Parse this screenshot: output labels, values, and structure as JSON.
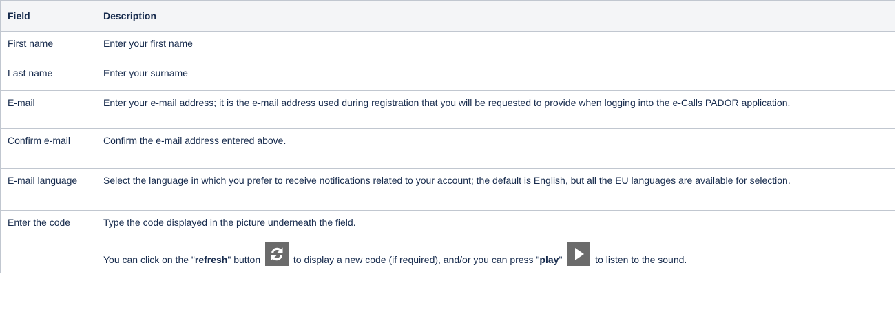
{
  "table": {
    "header": {
      "field": "Field",
      "description": "Description"
    },
    "rows": {
      "first_name": {
        "field": "First name",
        "description": "Enter your first name"
      },
      "last_name": {
        "field": "Last name",
        "description": "Enter your surname"
      },
      "email": {
        "field": "E-mail",
        "description": "Enter your e-mail address; it is the e-mail address used during registration that you will be requested to provide when logging into the e-Calls PADOR application."
      },
      "confirm_email": {
        "field": "Confirm e-mail",
        "description": "Confirm the e-mail address entered above."
      },
      "email_language": {
        "field": "E-mail language",
        "description": "Select the language in which you prefer to receive notifications related to your account; the default is English, but all the EU languages are available for selection."
      },
      "enter_code": {
        "field": "Enter the code",
        "description_line1": "Type the code displayed in the picture underneath the field.",
        "description_line2": {
          "part1": "You can click on the \"",
          "refresh_word": "refresh",
          "part2": "\" button ",
          "part3": " to display a new code (if required), and/or you can press \"",
          "play_word": "play",
          "part4": "\" ",
          "part5": " to listen to the sound."
        }
      }
    }
  },
  "icons": {
    "refresh": "refresh-icon",
    "play": "play-icon"
  },
  "colors": {
    "header_bg": "#f4f5f7",
    "border": "#c1c7d0",
    "icon_bg": "#6b6b6b",
    "icon_fg": "#ffffff"
  }
}
